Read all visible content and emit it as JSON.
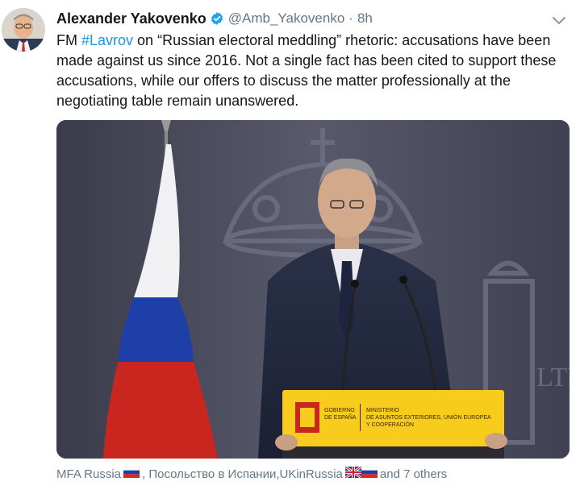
{
  "tweet": {
    "display_name": "Alexander Yakovenko",
    "handle": "@Amb_Yakovenko",
    "separator": "·",
    "time": "8h",
    "text_before": "FM ",
    "hashtag": "#Lavrov",
    "text_after": " on “Russian electoral meddling” rhetoric: accusations have been made against us since 2016. Not a single fact has been cited to support these accusations, while our offers to discuss the matter professionally at the negotiating table remain unanswered.",
    "podium_sign": {
      "left": "GOBIERNO\nDE ESPAÑA",
      "right": "MINISTERIO\nDE ASUNTOS EXTERIORES, UNIÓN EUROPEA\nY COOPERACIÓN"
    },
    "wall_text": "LTRA",
    "reply_context": {
      "name1": "MFA Russia",
      "sep1": ", Посольство в Испании, ",
      "name2": "UKinRussia",
      "tail": " and 7 others"
    }
  },
  "colors": {
    "link": "#1b95e0",
    "secondary_text": "#657786",
    "primary_text": "#14171a",
    "verified": "#1da1f2"
  }
}
